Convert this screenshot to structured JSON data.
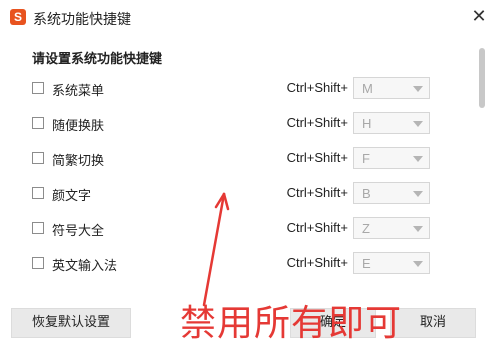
{
  "window": {
    "app_icon_letter": "S",
    "title": "系统功能快捷键",
    "close_symbol": "✕"
  },
  "section_title": "请设置系统功能快捷键",
  "rows": [
    {
      "label": "系统菜单",
      "prefix": "Ctrl+Shift+",
      "key": "M",
      "checked": false
    },
    {
      "label": "随便换肤",
      "prefix": "Ctrl+Shift+",
      "key": "H",
      "checked": false
    },
    {
      "label": "简繁切换",
      "prefix": "Ctrl+Shift+",
      "key": "F",
      "checked": false
    },
    {
      "label": "颜文字",
      "prefix": "Ctrl+Shift+",
      "key": "B",
      "checked": false
    },
    {
      "label": "符号大全",
      "prefix": "Ctrl+Shift+",
      "key": "Z",
      "checked": false
    },
    {
      "label": "英文输入法",
      "prefix": "Ctrl+Shift+",
      "key": "E",
      "checked": false
    }
  ],
  "footer": {
    "reset_label": "恢复默认设置",
    "ok_label": "确定",
    "cancel_label": "取消"
  },
  "annotation": {
    "text": "禁用所有即可",
    "color": "#e53935"
  },
  "colors": {
    "app_icon": "#e8531f"
  }
}
